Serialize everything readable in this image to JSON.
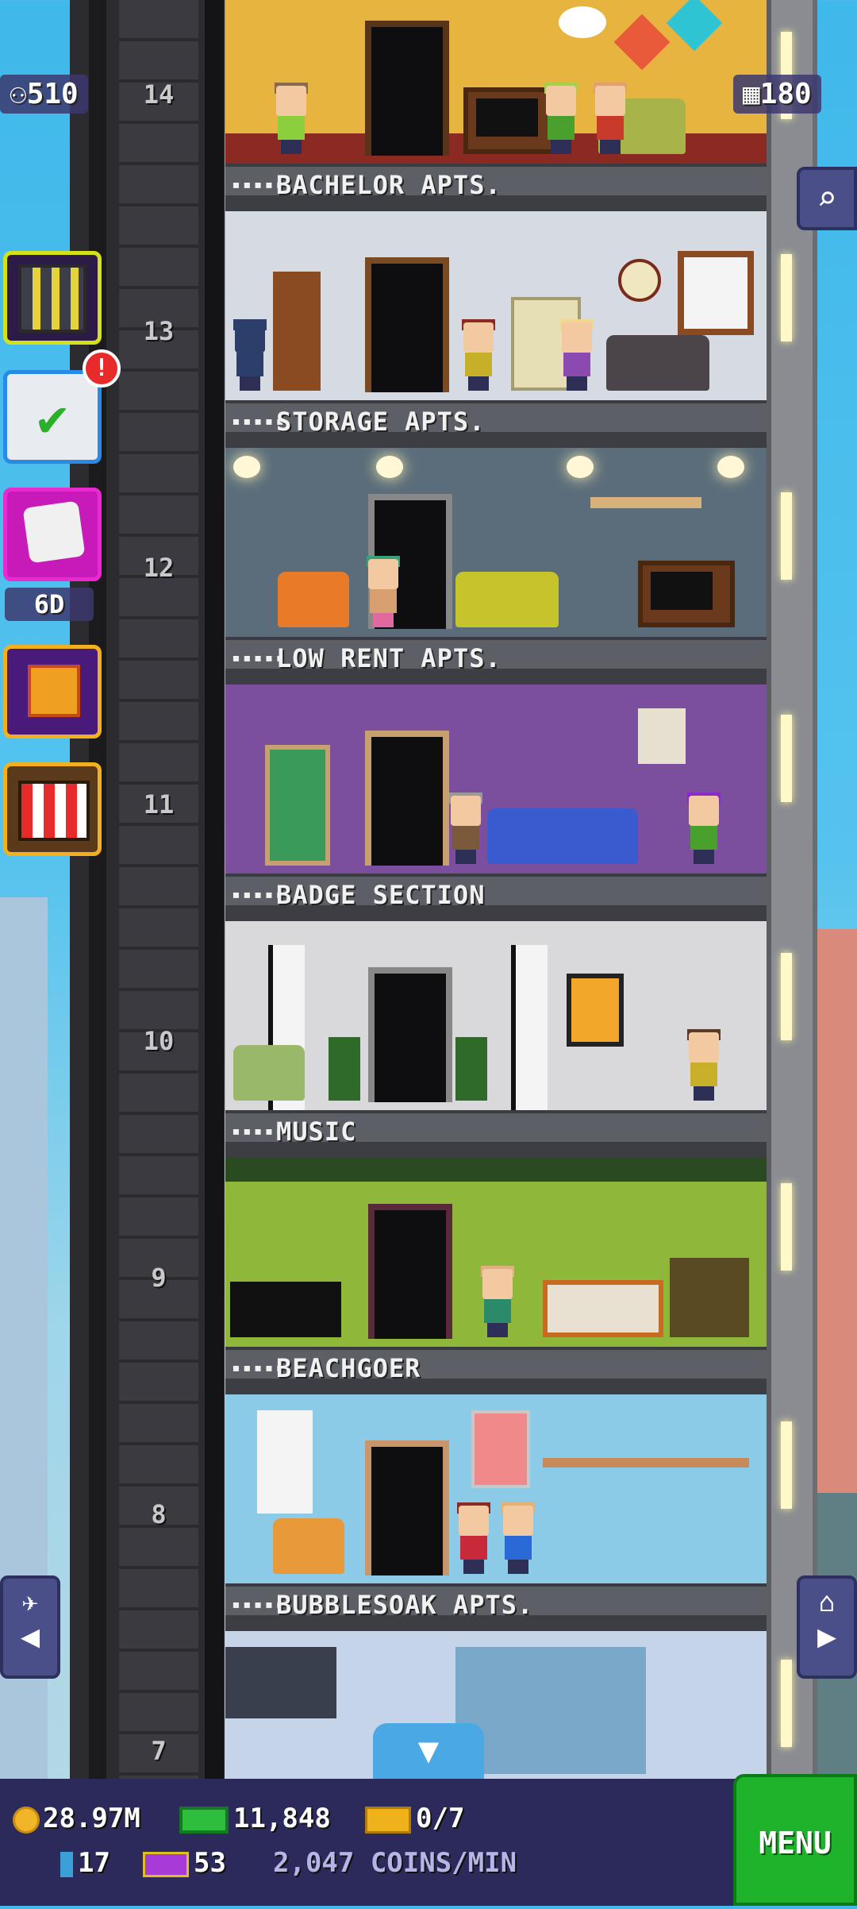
{
  "hud": {
    "population": "510",
    "floors": "180",
    "dice_timer": "6D",
    "notification_badge": "!"
  },
  "floors": [
    {
      "number": "14",
      "name": "BACHELOR APTS.",
      "stars": "▪▪▪▪▪",
      "bg": "#e7b23c"
    },
    {
      "number": "13",
      "name": "STORAGE APTS.",
      "stars": "▪▪▪▪▪",
      "bg": "#d9dde4"
    },
    {
      "number": "12",
      "name": "LOW RENT APTS.",
      "stars": "▪▪▪▪▪",
      "bg": "#5d6e7c"
    },
    {
      "number": "11",
      "name": "BADGE SECTION",
      "stars": "▪▪▪▪▪",
      "bg": "#7a4f9c"
    },
    {
      "number": "10",
      "name": "MUSIC",
      "stars": "▪▪▪▪▪",
      "bg": "#d9d9dc"
    },
    {
      "number": "9",
      "name": "BEACHGOER",
      "stars": "▪▪▪▪▪",
      "bg": "#8fb338"
    },
    {
      "number": "8",
      "name": "BUBBLESOAK APTS.",
      "stars": "▪▪▪▪▪",
      "bg": "#8bcbe8"
    },
    {
      "number": "7",
      "name": "",
      "stars": "",
      "bg": "#c9d6ea"
    }
  ],
  "bottom": {
    "coins": "28.97M",
    "bux": "11,848",
    "tickets": "0/7",
    "tokens": "17",
    "vip": "53",
    "rate": "2,047 COINS/MIN",
    "menu_label": "MENU",
    "dropdown_icon": "▼"
  },
  "icons": {
    "left_arrow": "◀",
    "right_arrow": "▶"
  }
}
